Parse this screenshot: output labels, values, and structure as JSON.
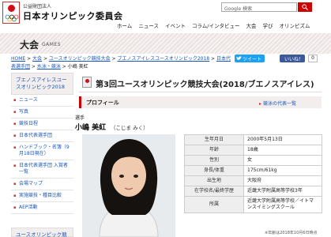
{
  "header": {
    "org_sub": "公益財団法人",
    "org_name": "日本オリンピック委員会",
    "search_placeholder": "Google 検索",
    "nav": [
      "ホーム",
      "ニュース",
      "イベント",
      "コラム/インタビュー",
      "大会",
      "学び",
      "オリンピズム"
    ]
  },
  "banner": {
    "title": "大会",
    "subtitle": "GAMES"
  },
  "breadcrumb": {
    "links": [
      "HOME",
      "大会",
      "ユースオリンピック競技大会",
      "ブエノスアイレスユースオリンピック2018",
      "日本代表選手団",
      "水泳・競泳"
    ],
    "separator": " > ",
    "current": "小嶋 美紅"
  },
  "share": {
    "tweet": "ツイート",
    "like": "いいね！0",
    "count": "0"
  },
  "sidebar": {
    "head": "ブエノスアイレスユースオリンピック2018",
    "items": [
      "ニュース",
      "写真",
      "競技日程",
      "日本代表選手団",
      "ハンドブック・名簿（9月18日現在）",
      "日本代表選手団 入賞者一覧",
      "会場マップ",
      "実施競技・種目比較",
      "AEP活動"
    ],
    "bottom": "ユースオリンピック競技"
  },
  "main": {
    "page_title": "第3回ユースオリンピック競技大会(2018/ブエノスアイレス)",
    "profile_label": "プロフィール",
    "back_link": "競泳の代表一覧",
    "role": "選手",
    "name": "小嶋 美紅",
    "kana": "（こじま みく）"
  },
  "profile_table": [
    {
      "label": "生年月日",
      "value": "2000年5月13日"
    },
    {
      "label": "年齢",
      "value": "18歳"
    },
    {
      "label": "性別",
      "value": "女"
    },
    {
      "label": "身長/体重",
      "value": "175cm/61kg"
    },
    {
      "label": "出生地",
      "value": "大阪府"
    },
    {
      "label": "在学校名/最終学歴",
      "value": "近畿大学附属高等学校3年"
    },
    {
      "label": "所属",
      "value": "近畿大学附属高等学校／イトマンスイミングスクール"
    }
  ],
  "updated": "※年齢は2018年10月6日時点",
  "colors": {
    "accent": "#c00000",
    "link": "#1a56b5",
    "twitter": "#1da1f2",
    "facebook": "#3b5998"
  }
}
